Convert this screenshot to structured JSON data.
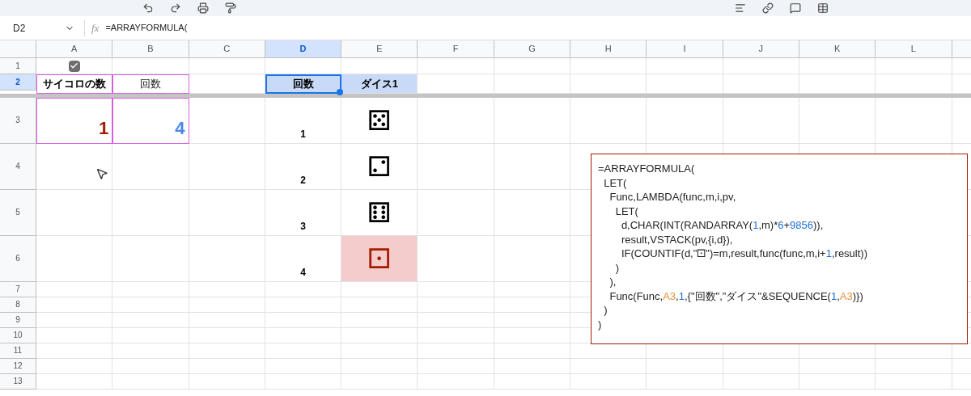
{
  "formula_bar": {
    "name_box": "D2",
    "fx_label": "fx",
    "formula": "=ARRAYFORMULA("
  },
  "columns": [
    {
      "label": "A",
      "selected": false
    },
    {
      "label": "B",
      "selected": false
    },
    {
      "label": "C",
      "selected": false
    },
    {
      "label": "D",
      "selected": true
    },
    {
      "label": "E",
      "selected": false
    },
    {
      "label": "F",
      "selected": false
    },
    {
      "label": "G",
      "selected": false
    },
    {
      "label": "H",
      "selected": false
    },
    {
      "label": "I",
      "selected": false
    },
    {
      "label": "J",
      "selected": false
    },
    {
      "label": "K",
      "selected": false
    },
    {
      "label": "L",
      "selected": false
    }
  ],
  "rows": [
    {
      "label": "1",
      "selected": false,
      "cells": [
        {
          "kind": "checkbox",
          "checked": true
        }
      ]
    },
    {
      "label": "2",
      "selected": true,
      "cells": [
        {
          "kind": "header",
          "text": "サイコロの数",
          "outlined": true,
          "filled": false,
          "selected": false
        },
        {
          "kind": "label",
          "text": "回数",
          "outlined": true
        },
        {
          "kind": "empty"
        },
        {
          "kind": "header",
          "text": "回数",
          "outlined": false,
          "filled": true,
          "selected": true
        },
        {
          "kind": "header",
          "text": "ダイス1",
          "outlined": false,
          "filled": true,
          "selected": false
        }
      ]
    },
    {
      "label": "3",
      "selected": false,
      "cells": [
        {
          "kind": "big",
          "text": "1",
          "color": "#a61c00",
          "outlined": true
        },
        {
          "kind": "big",
          "text": "4",
          "color": "#4a86e8",
          "outlined": true
        },
        {
          "kind": "empty"
        },
        {
          "kind": "count",
          "text": "1"
        },
        {
          "kind": "die",
          "text": "⚄",
          "highlighted": false
        }
      ]
    },
    {
      "label": "4",
      "selected": false,
      "cells": [
        {
          "kind": "empty"
        },
        {
          "kind": "empty"
        },
        {
          "kind": "empty"
        },
        {
          "kind": "count",
          "text": "2"
        },
        {
          "kind": "die",
          "text": "⚁",
          "highlighted": false
        }
      ]
    },
    {
      "label": "5",
      "selected": false,
      "cells": [
        {
          "kind": "empty"
        },
        {
          "kind": "empty"
        },
        {
          "kind": "empty"
        },
        {
          "kind": "count",
          "text": "3"
        },
        {
          "kind": "die",
          "text": "⚅",
          "highlighted": false
        }
      ]
    },
    {
      "label": "6",
      "selected": false,
      "cells": [
        {
          "kind": "empty"
        },
        {
          "kind": "empty"
        },
        {
          "kind": "empty"
        },
        {
          "kind": "count",
          "text": "4"
        },
        {
          "kind": "die",
          "text": "⚀",
          "highlighted": true
        }
      ]
    },
    {
      "label": "7",
      "selected": false
    },
    {
      "label": "8",
      "selected": false
    },
    {
      "label": "9",
      "selected": false
    },
    {
      "label": "10",
      "selected": false
    },
    {
      "label": "11",
      "selected": false
    },
    {
      "label": "12",
      "selected": false
    },
    {
      "label": "13",
      "selected": false
    }
  ],
  "formula_box": {
    "lines": [
      [
        {
          "kind": "plain",
          "text": "=ARRAYFORMULA("
        }
      ],
      [
        {
          "kind": "plain",
          "text": "  LET("
        }
      ],
      [
        {
          "kind": "plain",
          "text": "    Func,LAMBDA(func,m,i,pv,"
        }
      ],
      [
        {
          "kind": "plain",
          "text": "      LET("
        }
      ],
      [
        {
          "kind": "plain",
          "text": "        d,CHAR(INT(RANDARRAY("
        },
        {
          "kind": "number",
          "text": "1"
        },
        {
          "kind": "plain",
          "text": ",m)*"
        },
        {
          "kind": "number",
          "text": "6"
        },
        {
          "kind": "plain",
          "text": "+"
        },
        {
          "kind": "number",
          "text": "9856"
        },
        {
          "kind": "plain",
          "text": ")),"
        }
      ],
      [
        {
          "kind": "plain",
          "text": "        result,VSTACK(pv,{i,d}),"
        }
      ],
      [
        {
          "kind": "plain",
          "text": "        IF(COUNTIF(d,\"⚀\")=m,result,func(func,m,i+"
        },
        {
          "kind": "number",
          "text": "1"
        },
        {
          "kind": "plain",
          "text": ",result))"
        }
      ],
      [
        {
          "kind": "plain",
          "text": "      )"
        }
      ],
      [
        {
          "kind": "plain",
          "text": "    ),"
        }
      ],
      [
        {
          "kind": "plain",
          "text": "    Func(Func,"
        },
        {
          "kind": "ref",
          "text": "A3"
        },
        {
          "kind": "plain",
          "text": ","
        },
        {
          "kind": "number",
          "text": "1"
        },
        {
          "kind": "plain",
          "text": ",{\"回数\",\"ダイス\"&SEQUENCE("
        },
        {
          "kind": "number",
          "text": "1"
        },
        {
          "kind": "plain",
          "text": ","
        },
        {
          "kind": "ref",
          "text": "A3"
        },
        {
          "kind": "plain",
          "text": ")})"
        }
      ],
      [
        {
          "kind": "plain",
          "text": "  )"
        }
      ],
      [
        {
          "kind": "plain",
          "text": ")"
        }
      ]
    ]
  }
}
